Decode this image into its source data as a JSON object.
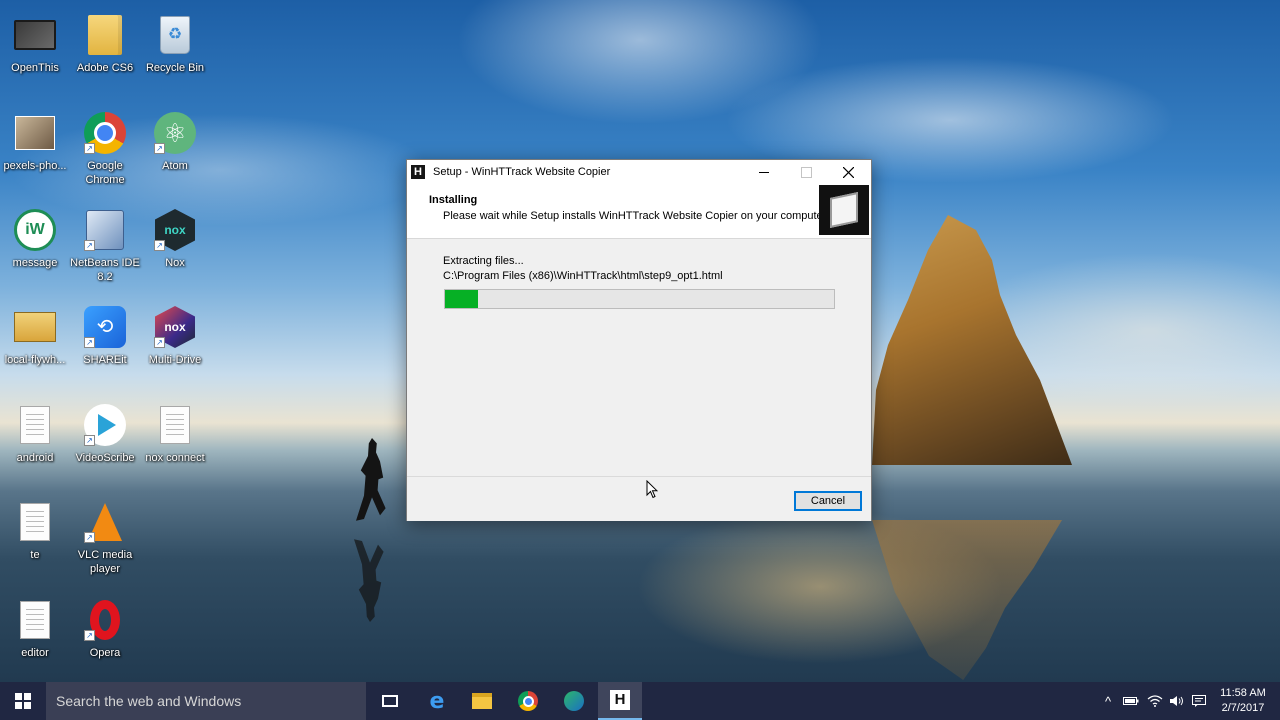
{
  "desktop_icons": [
    {
      "label": "OpenThis",
      "icon": "monitor-icon"
    },
    {
      "label": "Adobe CS6",
      "icon": "folder-icon"
    },
    {
      "label": "Recycle Bin",
      "icon": "recycle-bin-icon"
    },
    {
      "label": "pexels-pho...",
      "icon": "photo-icon"
    },
    {
      "label": "Google Chrome",
      "icon": "chrome-icon"
    },
    {
      "label": "Atom",
      "icon": "atom-icon"
    },
    {
      "label": "message",
      "icon": "iw-icon"
    },
    {
      "label": "NetBeans IDE 8.2",
      "icon": "netbeans-icon"
    },
    {
      "label": "Nox",
      "icon": "nox-icon"
    },
    {
      "label": "local-flywh...",
      "icon": "book-icon"
    },
    {
      "label": "SHAREit",
      "icon": "shareit-icon"
    },
    {
      "label": "Multi-Drive",
      "icon": "multi-drive-icon"
    },
    {
      "label": "android",
      "icon": "document-icon"
    },
    {
      "label": "VideoScribe",
      "icon": "videoscribe-icon"
    },
    {
      "label": "nox connect",
      "icon": "document-icon"
    },
    {
      "label": "te",
      "icon": "document-icon"
    },
    {
      "label": "VLC media player",
      "icon": "vlc-icon"
    },
    {
      "label": "editor",
      "icon": "document-icon"
    },
    {
      "label": "Opera",
      "icon": "opera-icon"
    }
  ],
  "dialog": {
    "title": "Setup - WinHTTrack Website Copier",
    "app_icon_letter": "H",
    "header_title": "Installing",
    "header_subtitle": "Please wait while Setup installs WinHTTrack Website Copier on your computer.",
    "status_label": "Extracting files...",
    "current_file": "C:\\Program Files (x86)\\WinHTTrack\\html\\step9_opt1.html",
    "progress_percent": 8.5,
    "cancel_label": "Cancel",
    "progress_color": "#06b025"
  },
  "taskbar": {
    "search_placeholder": "Search the web and Windows",
    "edge_letter": "e",
    "active_app_letter": "H",
    "pinned": [
      "task-view-icon",
      "edge-icon",
      "file-explorer-icon",
      "chrome-icon",
      "globe-icon",
      "winhttrack-icon"
    ],
    "tray_chevron": "^",
    "clock_time": "11:58 AM",
    "clock_date": "2/7/2017"
  },
  "colors": {
    "taskbar": "#121a36",
    "accent": "#0078d7"
  }
}
